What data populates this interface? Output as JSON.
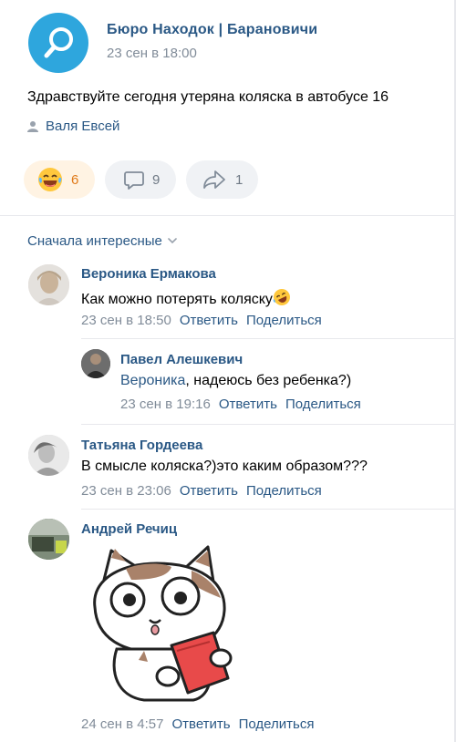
{
  "post": {
    "title": "Бюро Находок | Барановичи",
    "date": "23 сен в 18:00",
    "text": "Здравствуйте сегодня утеряна коляска в автобусе 16",
    "author": "Валя Евсей",
    "reactions": {
      "emoji_icon": "laughing-tears-emoji-icon",
      "count": "6"
    },
    "comments_count": "9",
    "shares_count": "1"
  },
  "comments_sort": {
    "label": "Сначала интересные"
  },
  "comments": [
    {
      "name": "Вероника Ермакова",
      "text": "Как можно потерять коляску",
      "date": "23 сен в 18:50",
      "reply": "Ответить",
      "share": "Поделиться"
    },
    {
      "name": "Павел Алешкевич",
      "mention": "Вероника",
      "text": ", надеюсь без ребенка?)",
      "date": "23 сен в 19:16",
      "reply": "Ответить",
      "share": "Поделиться"
    },
    {
      "name": "Татьяна Гордеева",
      "text": "В смысле коляска?)это каким образом???",
      "date": "23 сен в 23:06",
      "reply": "Ответить",
      "share": "Поделиться"
    },
    {
      "name": "Андрей Речиц",
      "sticker": "cat-reading-book-sticker",
      "date": "24 сен в 4:57",
      "reply": "Ответить",
      "share": "Поделиться"
    }
  ],
  "colors": {
    "link": "#2a5885",
    "meta": "#818c99",
    "accent_orange": "#e07b1a",
    "group_avatar": "#2ea6dd"
  }
}
